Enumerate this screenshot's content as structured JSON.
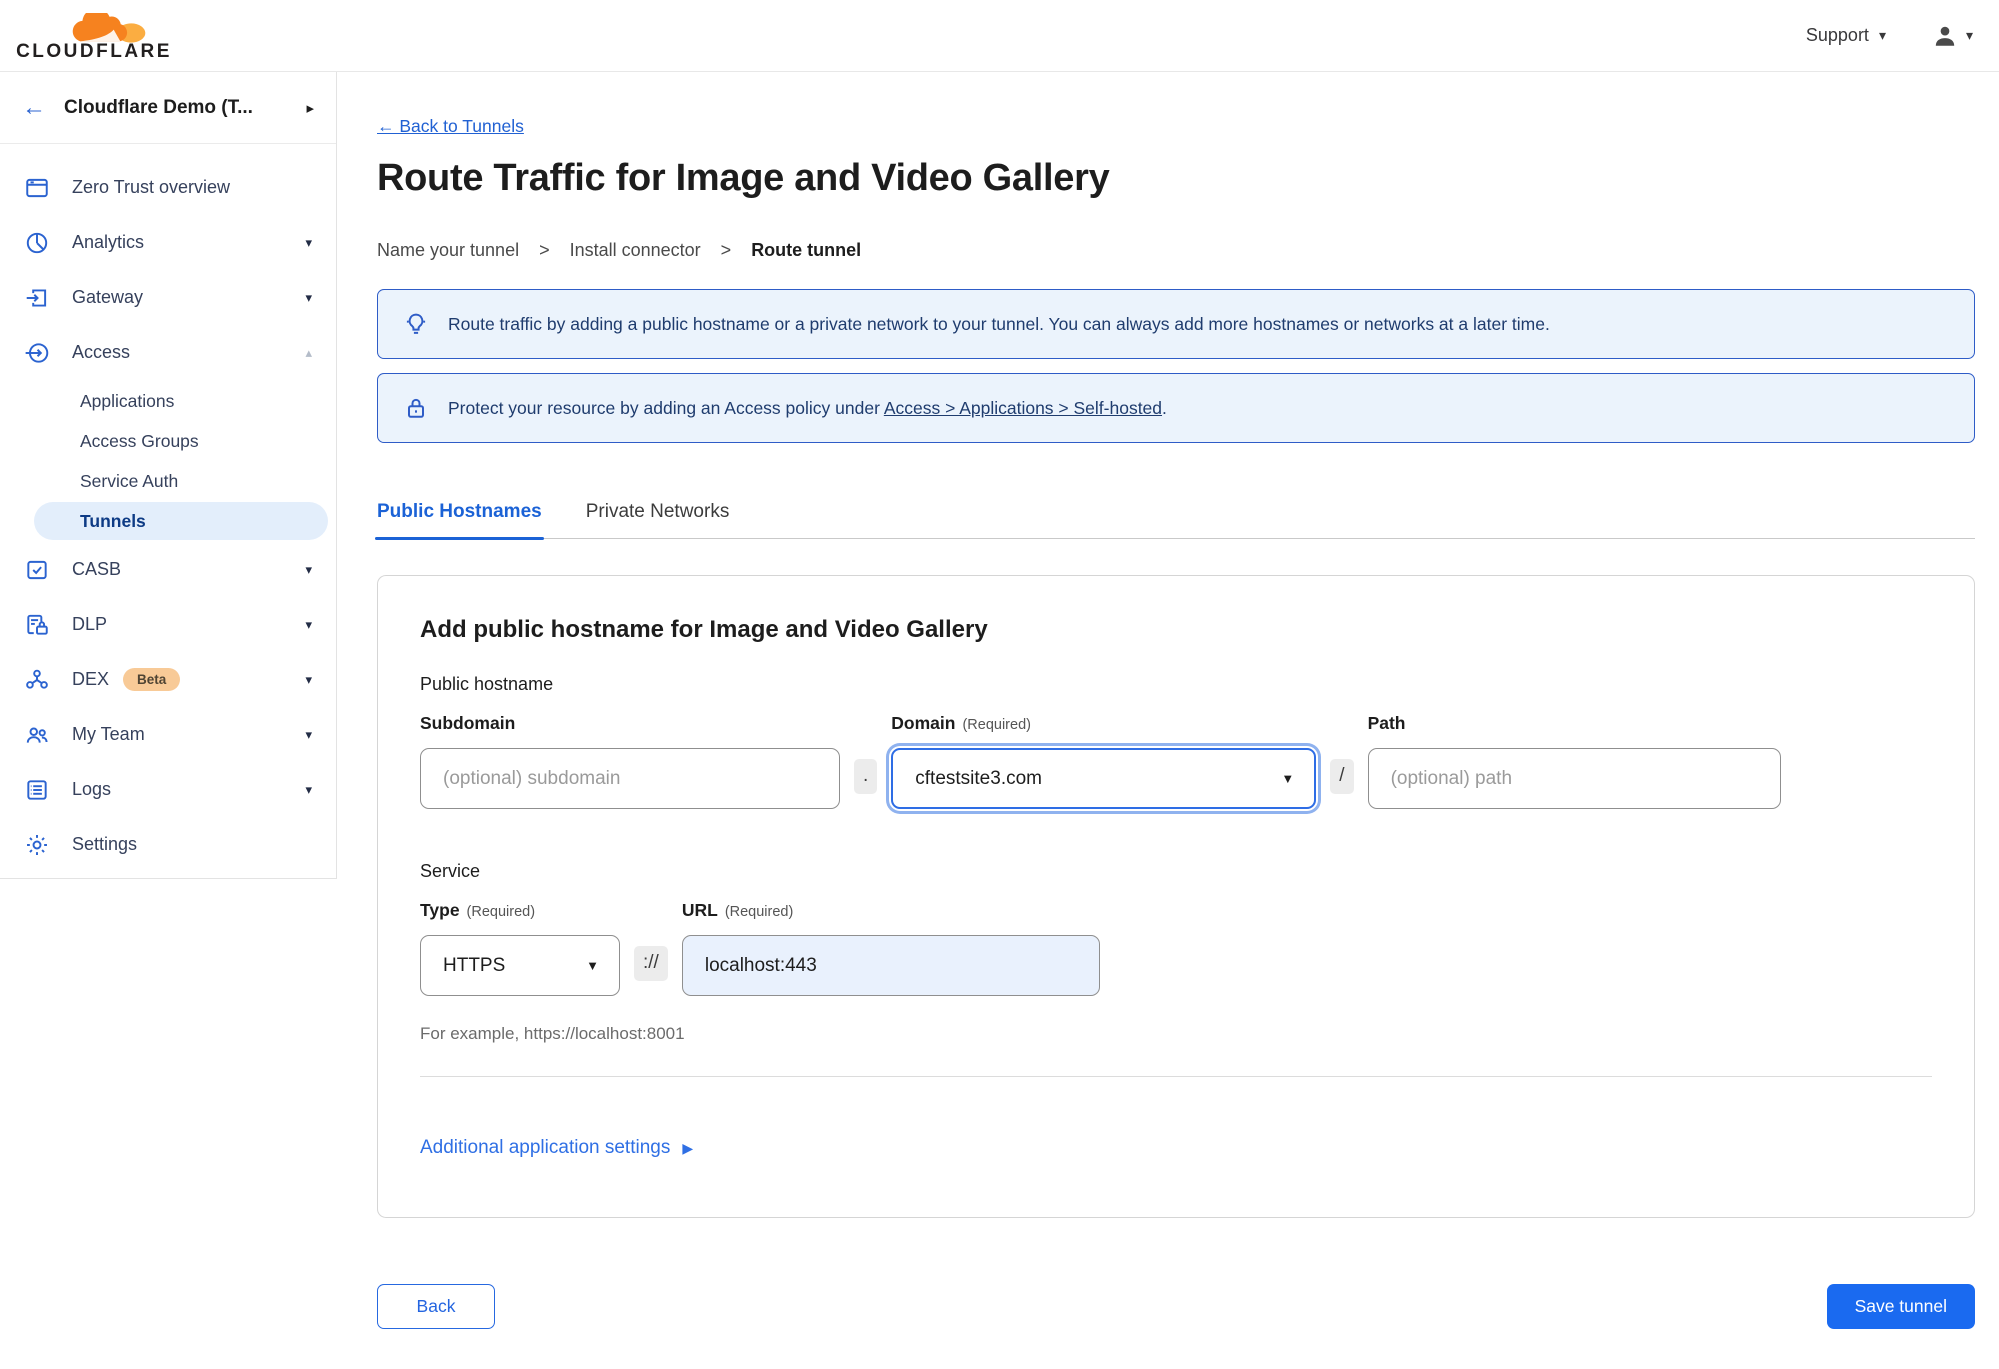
{
  "icons": {
    "caret_down": "▾",
    "caret_up": "▴",
    "expand_right": "▸",
    "select_caret": "▼",
    "link_caret": "▶",
    "back_arrow": "←"
  },
  "topbar": {
    "logo_text": "CLOUDFLARE",
    "support_label": "Support"
  },
  "sidebar": {
    "account_label": "Cloudflare Demo (T...",
    "items": [
      {
        "label": "Zero Trust overview"
      },
      {
        "label": "Analytics"
      },
      {
        "label": "Gateway"
      },
      {
        "label": "Access"
      },
      {
        "label": "CASB"
      },
      {
        "label": "DLP"
      },
      {
        "label": "DEX"
      },
      {
        "label": "My Team"
      },
      {
        "label": "Logs"
      },
      {
        "label": "Settings"
      }
    ],
    "dex_badge": "Beta",
    "access_children": [
      "Applications",
      "Access Groups",
      "Service Auth",
      "Tunnels"
    ],
    "active_child": "Tunnels"
  },
  "main": {
    "back_link": "← Back to Tunnels",
    "title": "Route Traffic for Image and Video Gallery",
    "steps": [
      "Name your tunnel",
      "Install connector",
      "Route tunnel"
    ],
    "step_separator": ">",
    "banners": [
      {
        "icon": "lightbulb-icon",
        "text": "Route traffic by adding a public hostname or a private network to your tunnel. You can always add more hostnames or networks at a later time."
      },
      {
        "icon": "lock-icon",
        "prefix": "Protect your resource by adding an Access policy under ",
        "link": "Access > Applications > Self-hosted",
        "suffix": "."
      }
    ],
    "tabs": [
      {
        "label": "Public Hostnames"
      },
      {
        "label": "Private Networks"
      }
    ],
    "form": {
      "card_title": "Add public hostname for Image and Video Gallery",
      "public_hostname_label": "Public hostname",
      "required_hint": "(Required)",
      "subdomain_label": "Subdomain",
      "subdomain_placeholder": "(optional) subdomain",
      "dot_separator": ".",
      "domain_label": "Domain",
      "domain_value": "cftestsite3.com",
      "slash_separator": "/",
      "path_label": "Path",
      "path_placeholder": "(optional) path",
      "service_label": "Service",
      "type_label": "Type",
      "type_value": "HTTPS",
      "scheme_separator": "://",
      "url_label": "URL",
      "url_value": "localhost:443",
      "example_hint": "For example, https://localhost:8001",
      "additional_settings_label": "Additional application settings"
    },
    "footer": {
      "back_label": "Back",
      "save_label": "Save tunnel"
    }
  },
  "colors": {
    "accent_blue": "#1a6af0",
    "link_blue": "#2161d3",
    "banner_border": "#2e5cc7",
    "banner_bg": "#ebf3fc",
    "active_pill_bg": "#e3eefb",
    "url_input_bg": "#e9f1fd",
    "logo_orange": "#f6821f",
    "logo_orange_light": "#fbad41",
    "beta_badge_bg": "#f8ca97"
  }
}
